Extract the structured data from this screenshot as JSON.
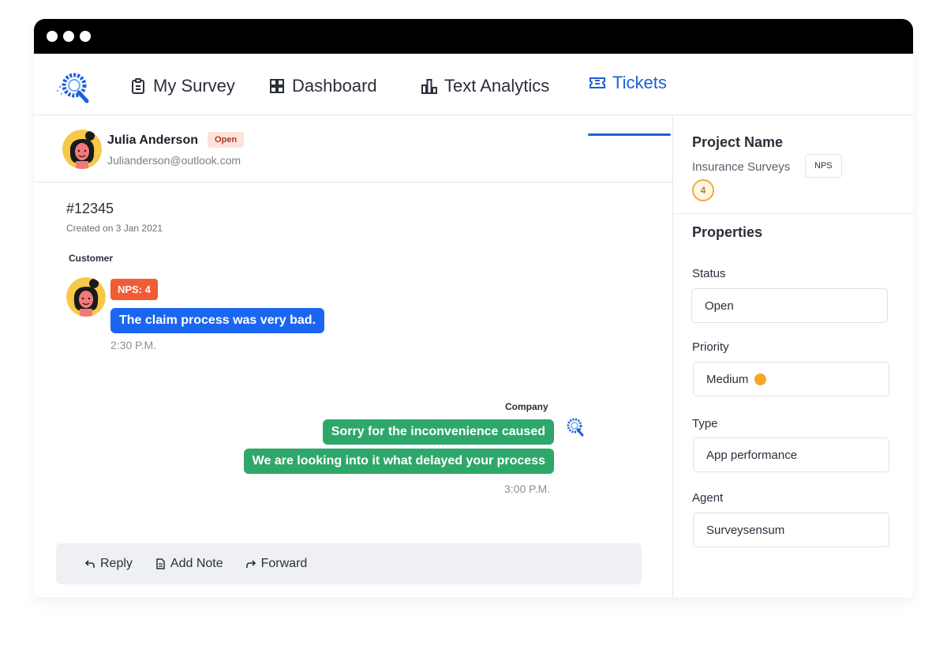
{
  "nav": {
    "items": [
      {
        "label": "My Survey",
        "icon": "clipboard-icon"
      },
      {
        "label": "Dashboard",
        "icon": "grid-icon"
      },
      {
        "label": "Text Analytics",
        "icon": "bar-chart-icon"
      },
      {
        "label": "Tickets",
        "icon": "ticket-icon"
      }
    ],
    "active": "Tickets",
    "accent_color": "#1d5fd6"
  },
  "contact": {
    "name": "Julia Anderson",
    "status": "Open",
    "email": "Julianderson@outlook.com"
  },
  "ticket": {
    "id": "#12345",
    "created": "Created on 3 Jan 2021"
  },
  "conversation": {
    "customer_label": "Customer",
    "nps_badge": "NPS: 4",
    "customer_message": "The claim process was very bad.",
    "customer_time": "2:30 P.M.",
    "company_label": "Company",
    "company_messages": [
      "Sorry for the inconvenience caused",
      "We are looking into it what delayed your process"
    ],
    "company_time": "3:00 P.M."
  },
  "actions": {
    "reply": "Reply",
    "add_note": "Add Note",
    "forward": "Forward"
  },
  "project": {
    "title": "Project Name",
    "name": "Insurance Surveys",
    "tag": "NPS",
    "score": "4"
  },
  "properties": {
    "title": "Properties",
    "status_label": "Status",
    "status_value": "Open",
    "priority_label": "Priority",
    "priority_value": "Medium",
    "priority_color": "#f5a623",
    "type_label": "Type",
    "type_value": "App performance",
    "agent_label": "Agent",
    "agent_value": "Surveysensum"
  },
  "colors": {
    "customer_bubble": "#1a66f0",
    "company_bubble": "#2ea86a",
    "nps_badge": "#f25c34"
  }
}
